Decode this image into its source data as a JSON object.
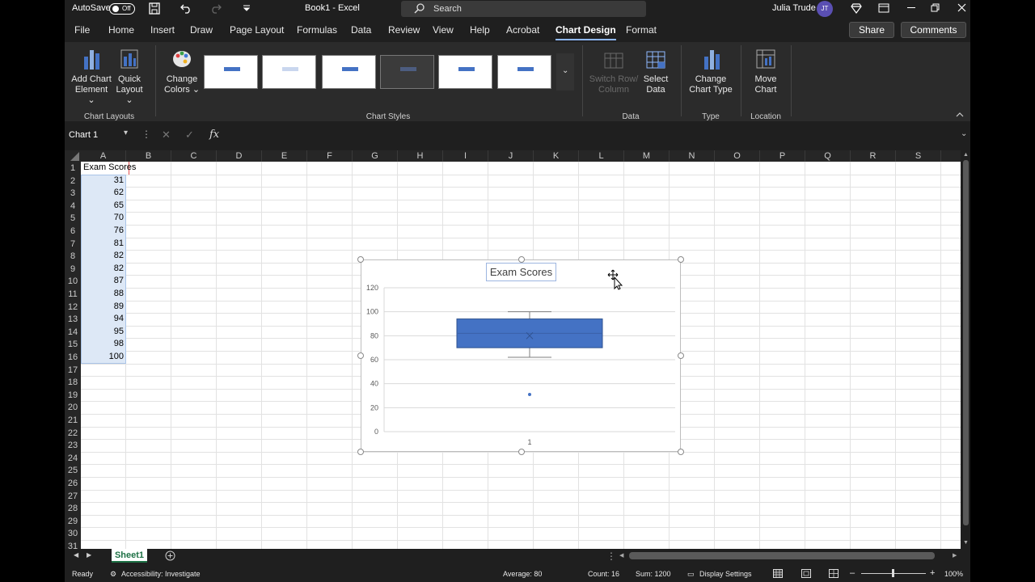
{
  "titlebar": {
    "autosave_label": "AutoSave",
    "autosave_state": "Off",
    "doc_title": "Book1  -  Excel",
    "search_placeholder": "Search",
    "user_name": "Julia Trude",
    "user_initials": "JT"
  },
  "tabs": [
    "File",
    "Home",
    "Insert",
    "Draw",
    "Page Layout",
    "Formulas",
    "Data",
    "Review",
    "View",
    "Help",
    "Acrobat",
    "Chart Design",
    "Format"
  ],
  "active_tab": "Chart Design",
  "share_label": "Share",
  "comments_label": "Comments",
  "ribbon": {
    "add_chart_element": [
      "Add Chart",
      "Element"
    ],
    "quick_layout": [
      "Quick",
      "Layout"
    ],
    "change_colors": [
      "Change",
      "Colors"
    ],
    "switch_row_column": [
      "Switch Row/",
      "Column"
    ],
    "select_data": [
      "Select",
      "Data"
    ],
    "change_chart_type": [
      "Change",
      "Chart Type"
    ],
    "move_chart": [
      "Move",
      "Chart"
    ],
    "groups": {
      "chart_layouts": "Chart Layouts",
      "chart_styles": "Chart Styles",
      "data": "Data",
      "type": "Type",
      "location": "Location"
    }
  },
  "formula_bar": {
    "name_box": "Chart 1",
    "fx_label": "fx",
    "value": ""
  },
  "columns": [
    "A",
    "B",
    "C",
    "D",
    "E",
    "F",
    "G",
    "H",
    "I",
    "J",
    "K",
    "L",
    "M",
    "N",
    "O",
    "P",
    "Q",
    "R",
    "S"
  ],
  "rows": [
    "1",
    "2",
    "3",
    "4",
    "5",
    "6",
    "7",
    "8",
    "9",
    "10",
    "11",
    "12",
    "13",
    "14",
    "15",
    "16",
    "17",
    "18",
    "19",
    "20",
    "21",
    "22",
    "23",
    "24",
    "25",
    "26",
    "27",
    "28",
    "29",
    "30",
    "31"
  ],
  "cells": {
    "A1": "Exam Scores",
    "A_values": [
      "31",
      "62",
      "65",
      "70",
      "76",
      "81",
      "82",
      "82",
      "87",
      "88",
      "89",
      "94",
      "95",
      "98",
      "100"
    ]
  },
  "chart_data": {
    "type": "box",
    "title": "Exam Scores",
    "categories": [
      "1"
    ],
    "yticks": [
      "0",
      "20",
      "40",
      "60",
      "80",
      "100",
      "120"
    ],
    "ylim": [
      0,
      120
    ],
    "series": [
      {
        "min": 62,
        "q1": 70,
        "median": 82,
        "mean": 80,
        "q3": 94,
        "max": 100,
        "outliers": [
          31
        ]
      }
    ],
    "box_color": "#4472c4"
  },
  "sheet_tab": "Sheet1",
  "status": {
    "ready": "Ready",
    "accessibility": "Accessibility: Investigate",
    "average": "Average: 80",
    "count": "Count: 16",
    "sum": "Sum: 1200",
    "display_settings": "Display Settings",
    "zoom": "100%"
  }
}
